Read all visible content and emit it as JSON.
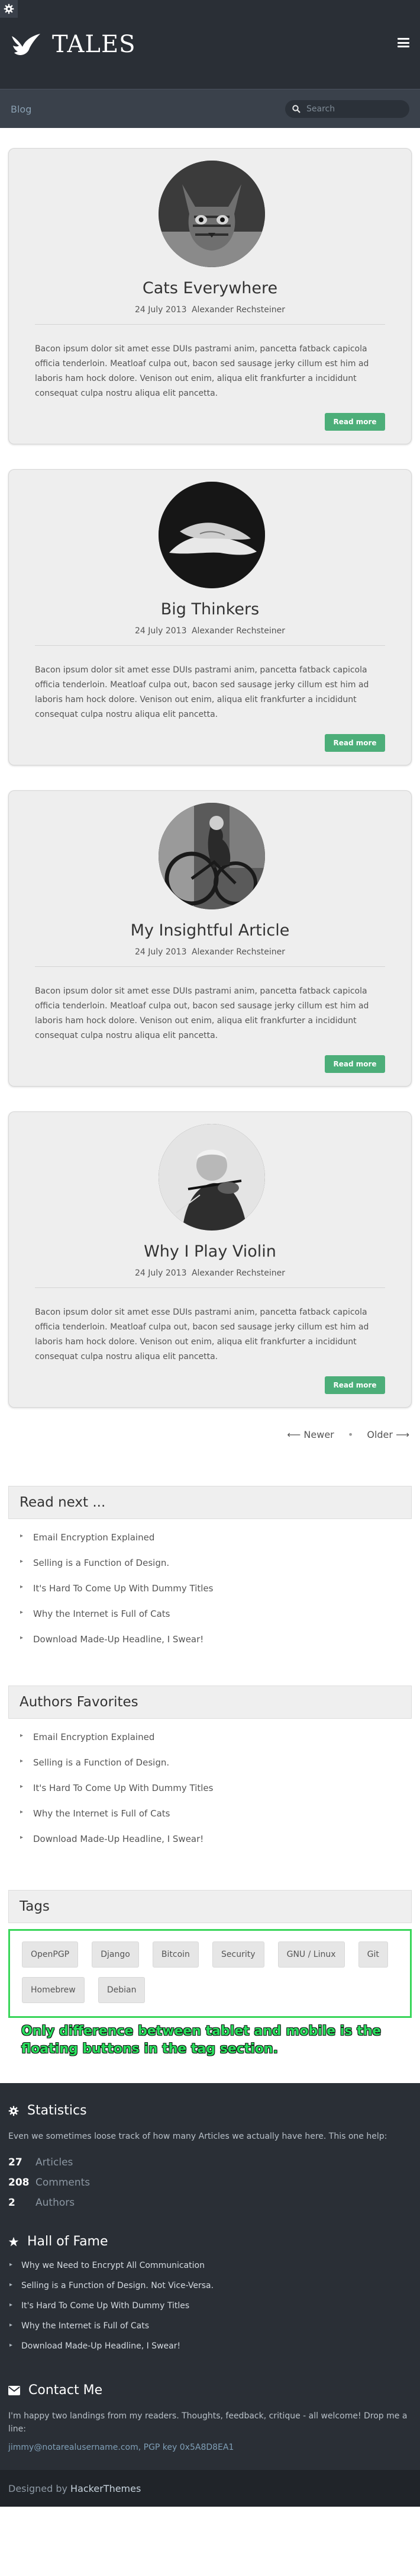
{
  "header": {
    "site_title": "TALES",
    "breadcrumb": "Blog",
    "search_placeholder": "Search"
  },
  "articles": [
    {
      "title": "Cats Everywhere",
      "date": "24 July 2013",
      "author": "Alexander Rechsteiner",
      "excerpt": "Bacon ipsum dolor sit amet esse DUIs pastrami anim, pancetta fatback capicola officia tenderloin. Meatloaf culpa out, bacon sed sausage jerky cillum est him ad laboris ham hock dolore. Venison out enim, aliqua elit frankfurter a incididunt consequat culpa nostru aliqua elit pancetta.",
      "button": "Read more",
      "image": "cat-photo"
    },
    {
      "title": "Big Thinkers",
      "date": "24 July 2013",
      "author": "Alexander Rechsteiner",
      "excerpt": "Bacon ipsum dolor sit amet esse DUIs pastrami anim, pancetta fatback capicola officia tenderloin. Meatloaf culpa out, bacon sed sausage jerky cillum est him ad laboris ham hock dolore. Venison out enim, aliqua elit frankfurter a incididunt consequat culpa nostru aliqua elit pancetta.",
      "button": "Read more",
      "image": "hands-photo"
    },
    {
      "title": "My Insightful Article",
      "date": "24 July 2013",
      "author": "Alexander Rechsteiner",
      "excerpt": "Bacon ipsum dolor sit amet esse DUIs pastrami anim, pancetta fatback capicola officia tenderloin. Meatloaf culpa out, bacon sed sausage jerky cillum est him ad laboris ham hock dolore. Venison out enim, aliqua elit frankfurter a incididunt consequat culpa nostru aliqua elit pancetta.",
      "button": "Read more",
      "image": "bicycle-man-photo"
    },
    {
      "title": "Why I Play Violin",
      "date": "24 July 2013",
      "author": "Alexander Rechsteiner",
      "excerpt": "Bacon ipsum dolor sit amet esse DUIs pastrami anim, pancetta fatback capicola officia tenderloin. Meatloaf culpa out, bacon sed sausage jerky cillum est him ad laboris ham hock dolore. Venison out enim, aliqua elit frankfurter a incididunt consequat culpa nostru aliqua elit pancetta.",
      "button": "Read more",
      "image": "violinist-photo"
    }
  ],
  "pager": {
    "newer": "⟵ Newer",
    "separator": "•",
    "older": "Older ⟶"
  },
  "read_next": {
    "title": "Read next ...",
    "items": [
      "Email Encryption Explained",
      "Selling is a Function of Design.",
      "It's Hard To Come Up With Dummy Titles",
      "Why the Internet is Full of Cats",
      "Download Made-Up Headline, I Swear!"
    ]
  },
  "favorites": {
    "title": "Authors Favorites",
    "items": [
      "Email Encryption Explained",
      "Selling is a Function of Design.",
      "It's Hard To Come Up With Dummy Titles",
      "Why the Internet is Full of Cats",
      "Download Made-Up Headline, I Swear!"
    ]
  },
  "tags": {
    "title": "Tags",
    "items": [
      "OpenPGP",
      "Django",
      "Bitcoin",
      "Security",
      "GNU / Linux",
      "Git",
      "Homebrew",
      "Debian"
    ]
  },
  "annotation": "Only difference between tablet and mobile is the floating buttons in the tag section.",
  "footer": {
    "statistics": {
      "title": "Statistics",
      "text": "Even we sometimes loose track of how many Articles we actually have here. This one help:",
      "items": [
        {
          "count": "27",
          "label": "Articles"
        },
        {
          "count": "208",
          "label": "Comments"
        },
        {
          "count": "2",
          "label": "Authors"
        }
      ]
    },
    "hall_of_fame": {
      "title": "Hall of Fame",
      "items": [
        "Why we Need to Encrypt All Communication",
        "Selling is a Function of Design. Not Vice-Versa.",
        "It's Hard To Come Up With Dummy Titles",
        "Why the Internet is Full of Cats",
        "Download Made-Up Headline, I Swear!"
      ]
    },
    "contact": {
      "title": "Contact Me",
      "text": "I'm happy two landings from my readers. Thoughts, feedback, critique - all welcome! Drop me a line:",
      "email": "jimmy@notarealusername.com, PGP key 0x5A8D8EA1"
    },
    "credit_prefix": "Designed by ",
    "credit_link": "HackerThemes"
  },
  "colors": {
    "header_bg": "#2a2f36",
    "subbar_bg": "#3a414b",
    "accent_button": "#4cae79",
    "annotation_green": "#29e05d",
    "card_bg": "#eeeeee"
  }
}
